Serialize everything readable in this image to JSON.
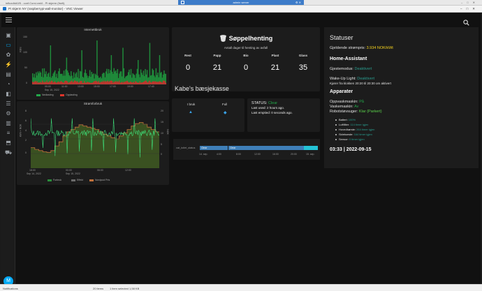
{
  "outer_window": {
    "title": "influxdbA0/5 - conf.Corsi.xml4 - Pi skjerm (frwfi).",
    "controls": [
      "–",
      "□",
      "✕"
    ]
  },
  "vnc_window": {
    "title": "Pi skjerm NY (raspberrypi-wall-monitor) - VNC Viewer",
    "controls": [
      "–",
      "□",
      "✕"
    ]
  },
  "vnc_toolbar": {
    "title": "admin server"
  },
  "ha_header": {
    "menu_icon": "menu-icon",
    "search_icon": "search-icon"
  },
  "sidebar": {
    "items": [
      {
        "icon": "overview-icon",
        "glyph": "▣"
      },
      {
        "icon": "monitor-icon",
        "glyph": "▭"
      },
      {
        "icon": "pet-icon",
        "glyph": "✿"
      },
      {
        "icon": "lightning-icon",
        "glyph": "⚡"
      },
      {
        "icon": "radiator-icon",
        "glyph": "▤"
      },
      {
        "icon": "thermostat-icon",
        "glyph": "◔"
      },
      {
        "icon": "car-icon",
        "glyph": "◧"
      },
      {
        "icon": "history-icon",
        "glyph": "☰"
      },
      {
        "icon": "energy-icon",
        "glyph": "⚙"
      },
      {
        "icon": "clipboard-icon",
        "glyph": "▥"
      },
      {
        "icon": "list-icon",
        "glyph": "≡"
      },
      {
        "icon": "map-icon",
        "glyph": "⬒"
      },
      {
        "icon": "cart-icon",
        "glyph": "⛟"
      }
    ],
    "active_index": 1,
    "avatar_letter": "M"
  },
  "internett_chart": {
    "title": "Internettbruk",
    "ylabel": "KB/s",
    "y_ticks": [
      "150",
      "100",
      "50",
      "0"
    ],
    "x_ticks": [
      "09:00",
      "11:00",
      "13:00",
      "15:00",
      "17:00",
      "19:00",
      "17:40"
    ],
    "x_date": "Sep 15, 2022",
    "legend": [
      {
        "name": "Nedlasting",
        "color": "#23a94a"
      },
      {
        "name": "Opplasting",
        "color": "#e0352b"
      }
    ]
  },
  "strom_chart": {
    "title": "Strømforbruk",
    "ylabel_left": "kWh + NOK",
    "ylabel_right": "NOK",
    "y_ticks": [
      "8",
      "6",
      "4",
      "2",
      "0"
    ],
    "y_ticks_right": [
      "20",
      "15",
      "10",
      "5",
      "0"
    ],
    "x_ticks": [
      "18:00",
      "00:00",
      "06:00",
      "12:00"
    ],
    "x_dates": [
      "Sep 14, 2022",
      "Sep 15, 2022"
    ],
    "legend": [
      {
        "name": "Forbruk",
        "color": "#2a8c3b"
      },
      {
        "name": "Effekt",
        "color": "#6a6a6a"
      },
      {
        "name": "Nordpool Pris",
        "color": "#c0703a"
      }
    ]
  },
  "garbage": {
    "icon": "trash-icon",
    "title": "Søppelhenting",
    "subtitle": "Antall dager til henting av avfall",
    "columns": [
      {
        "name": "Rest",
        "value": "0"
      },
      {
        "name": "Papp",
        "value": "21"
      },
      {
        "name": "Bio",
        "value": "0"
      },
      {
        "name": "Plast",
        "value": "21"
      },
      {
        "name": "Glass",
        "value": "35"
      }
    ]
  },
  "litter": {
    "title": "Kabe's bæsjekasse",
    "in_use_label": "I bruk",
    "full_label": "Full",
    "status_label": "STATUS:",
    "status_value": "Clear",
    "last_used": "Last used: 2 hours ago.",
    "last_emptied": "Last emptied: 0 seconds ago.",
    "timeline": {
      "entity": "cat_toilet_status",
      "segments": [
        "Clear",
        "Clear"
      ],
      "ticks": [
        "14. sep.",
        "4:00",
        "8:00",
        "12:00",
        "16:00",
        "20:00",
        "15. sep."
      ]
    }
  },
  "status": {
    "title": "Statuser",
    "power_price_label": "Gjeldende strømpris:",
    "power_price_value": "3.934 NOK/kWt",
    "ha_title": "Home-Assistant",
    "guest_label": "Gjestemodus:",
    "guest_value": "Deaktivert",
    "wake_label": "Wake-Up Light:",
    "wake_value": "Deaktivert",
    "wake_note": "Kjører fra klokken 20:20 til 20:30 om aktivert",
    "appliances_title": "Apparater",
    "dishwasher_label": "Oppvaskmaskin:",
    "dishwasher_value": "På",
    "washer_label": "Vaskemaskin:",
    "washer_value": "Av",
    "robot_label": "Robotstøvsuger:",
    "robot_value": "Klar (Parkert)",
    "robot_details": [
      {
        "label": "Batteri:",
        "value": "100%"
      },
      {
        "label": "Luftfilter:",
        "value": "114 timer igjen"
      },
      {
        "label": "Hovedbørste:",
        "value": "264 timer igjen"
      },
      {
        "label": "Sidebørste:",
        "value": "164 timer igjen"
      },
      {
        "label": "Sensor:",
        "value": "0 timer igjen"
      }
    ],
    "datetime": "03:33 | 2022-09-15"
  },
  "taskbar": {
    "left_text": "Notifications",
    "items_text": "20 items",
    "selected_text": "1 item selected  1,58 KB"
  },
  "colors": {
    "accent": "#03a9f4",
    "green": "#23a94a",
    "red": "#e0352b",
    "yellow": "#f5d21d",
    "teal": "#2a9d8f"
  }
}
